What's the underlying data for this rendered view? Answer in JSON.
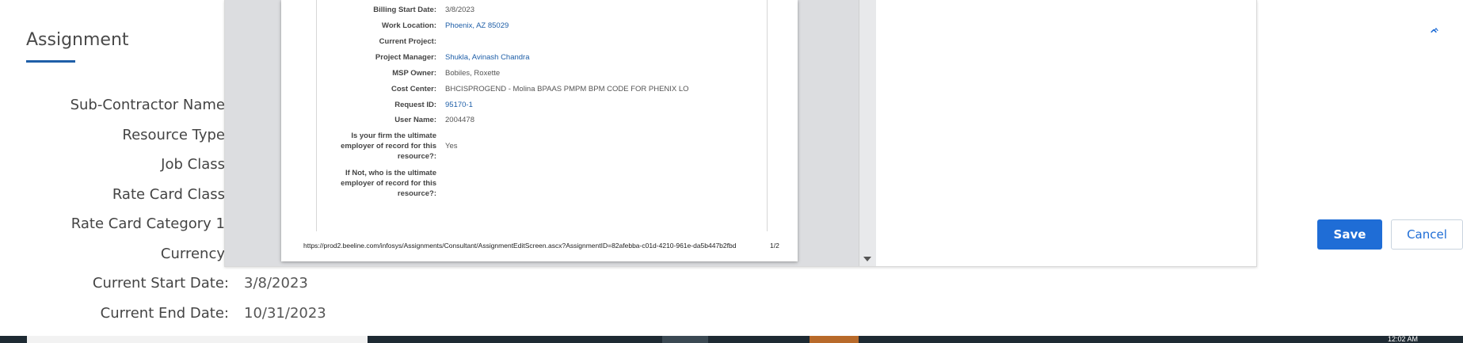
{
  "page": {
    "title": "Assignment",
    "fields": [
      {
        "label": "Sub-Contractor Name",
        "value": ""
      },
      {
        "label": "Resource Type",
        "value": ""
      },
      {
        "label": "Job Class",
        "value": ""
      },
      {
        "label": "Rate Card Class",
        "value": ""
      },
      {
        "label": "Rate Card Category 1",
        "value": ""
      },
      {
        "label": "Currency",
        "value": ""
      },
      {
        "label": "Current Start Date:",
        "value": "3/8/2023"
      },
      {
        "label": "Current End Date:",
        "value": "10/31/2023"
      }
    ]
  },
  "pdf": {
    "rows": [
      {
        "label": "Billing Start Date:",
        "value": "3/8/2023",
        "link": false
      },
      {
        "label": "Work Location:",
        "value": "Phoenix, AZ 85029",
        "link": true
      },
      {
        "label": "Current Project:",
        "value": "",
        "link": false
      },
      {
        "label": "Project Manager:",
        "value": "Shukla, Avinash Chandra",
        "link": true
      },
      {
        "label": "MSP Owner:",
        "value": "Bobiles, Roxette",
        "link": false
      },
      {
        "label": "Cost Center:",
        "value": "BHCISPROGEND - Molina BPAAS PMPM BPM CODE FOR PHENIX LO",
        "link": false
      },
      {
        "label": "Request ID:",
        "value": "95170-1",
        "link": true
      },
      {
        "label": "User Name:",
        "value": "2004478",
        "link": false
      },
      {
        "label": "Is your firm the ultimate employer of record for this resource?:",
        "value": "Yes",
        "link": false
      },
      {
        "label": "If Not, who is the ultimate employer of record for this resource?:",
        "value": "",
        "link": false
      }
    ],
    "footer_url": "https://prod2.beeline.com/infosys/Assignments/Consultant/AssignmentEditScreen.ascx?AssignmentID=82afebba-c01d-4210-961e-da5b447b2fbd",
    "page_indicator": "1/2"
  },
  "modal": {
    "save_label": "Save",
    "cancel_label": "Cancel"
  },
  "taskbar": {
    "clock": "12:02 AM"
  },
  "colors": {
    "accent": "#1f6dd6",
    "link": "#1f5fa8",
    "taskbar": "#1e2a33"
  }
}
